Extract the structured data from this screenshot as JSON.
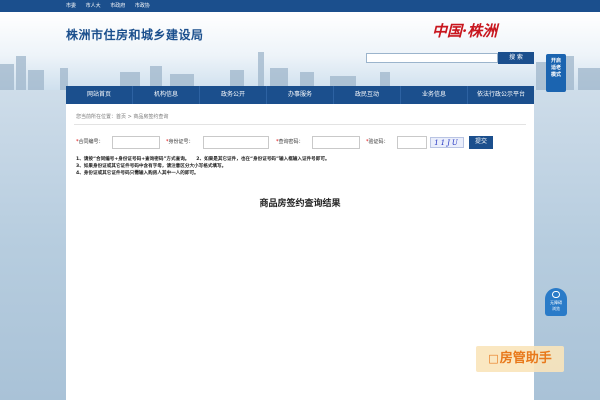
{
  "top_links": [
    "市委",
    "市人大",
    "市政府",
    "市政协"
  ],
  "header": {
    "site_title": "株洲市住房和城乡建设局",
    "slogan": "中国·株洲",
    "search_button": "搜 索",
    "search_value": ""
  },
  "nav": {
    "items": [
      "网站首页",
      "机构信息",
      "政务公开",
      "办事服务",
      "政民互动",
      "业务信息",
      "依法行政公示平台"
    ]
  },
  "float_widgets": {
    "top": [
      "开启",
      "适老",
      "模式"
    ],
    "mid": [
      "无障碍",
      "浏览"
    ]
  },
  "breadcrumb": "您当前所在位置：首页 > 商品房签约查询",
  "form": {
    "contract_no_label": "合同编号：",
    "id_no_label": "身份证号：",
    "query_pwd_label": "查询密码：",
    "captcha_label": "验证码：",
    "contract_no_value": "",
    "id_no_value": "",
    "query_pwd_value": "",
    "captcha_value": "",
    "captcha_image_text": "11JU",
    "submit_label": "提交"
  },
  "notes": [
    "1、请按“合同编号+身份证号码+查询密码”方式查询。　　2、如果是其它证件，也在“身份证号码”输入框输入证件号即可。",
    "3、如果身份证或其它证件号码中含有字母，请注意区分大小写格式填写。",
    "4、身份证或其它证件号码只需输入购房人其中一人的即可。"
  ],
  "result_title": "商品房签约查询结果",
  "assistant_badge": "房管助手",
  "colors": {
    "primary": "#1b4f8d",
    "slogan_red": "#c8161e",
    "assistant_orange": "#e8791c"
  }
}
